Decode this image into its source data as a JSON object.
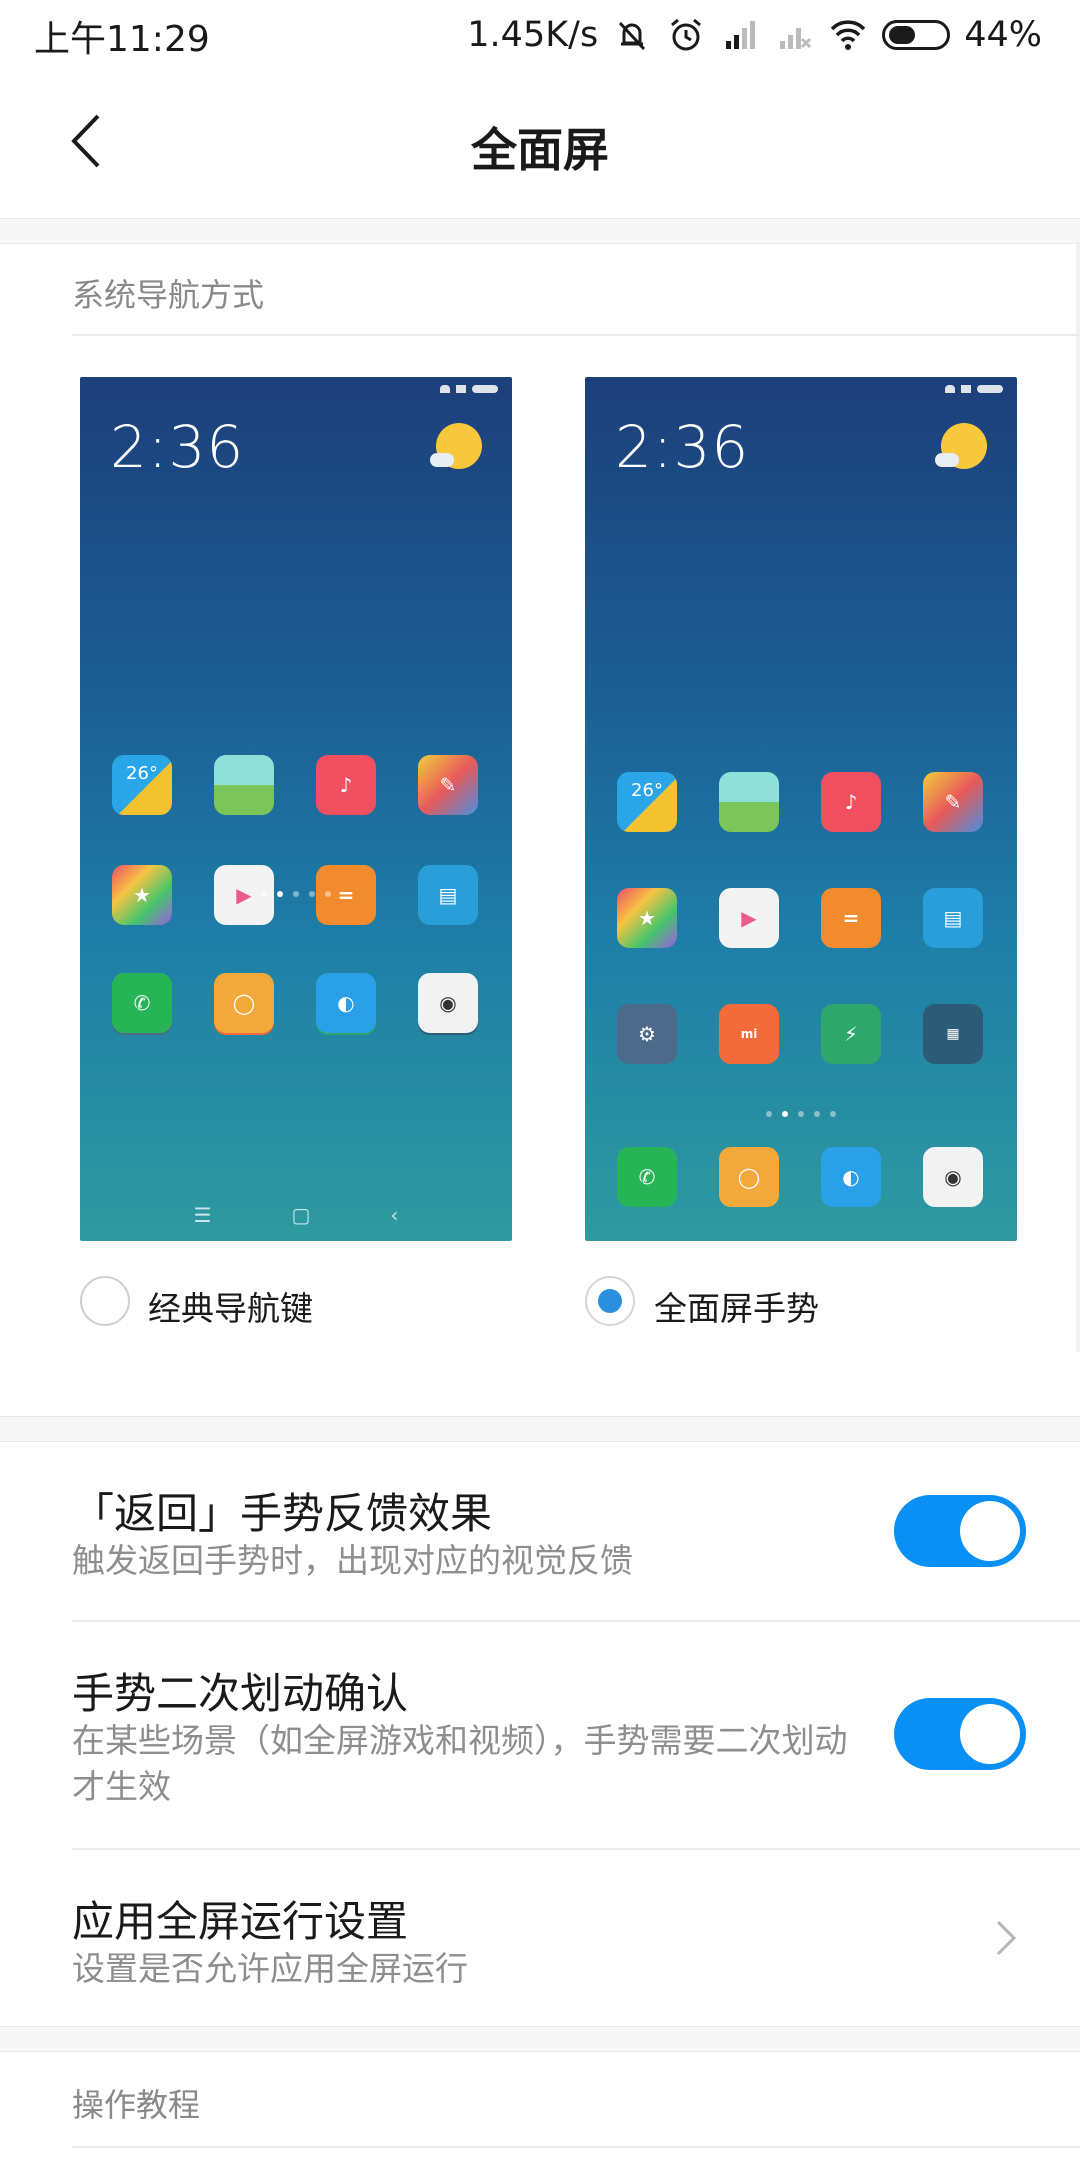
{
  "status_bar": {
    "time": "上午11:29",
    "net_speed": "1.45K/s",
    "battery": "44%"
  },
  "header": {
    "title": "全面屏"
  },
  "navigation_section": {
    "label": "系统导航方式",
    "options": [
      {
        "label": "经典导航键",
        "selected": false
      },
      {
        "label": "全面屏手势",
        "selected": true
      }
    ],
    "preview_clock": "2:36",
    "preview_weather_temp": "26°"
  },
  "settings": [
    {
      "title": "「返回」手势反馈效果",
      "subtitle": "触发返回手势时，出现对应的视觉反馈",
      "toggle_on": true
    },
    {
      "title": "手势二次划动确认",
      "subtitle": "在某些场景（如全屏游戏和视频），手势需要二次划动才生效",
      "toggle_on": true
    },
    {
      "title": "应用全屏运行设置",
      "subtitle": "设置是否允许应用全屏运行"
    }
  ],
  "tutorial_section": {
    "label": "操作教程"
  },
  "colors": {
    "accent": "#0a8ff5",
    "radio_selected": "#2b8fe0"
  }
}
